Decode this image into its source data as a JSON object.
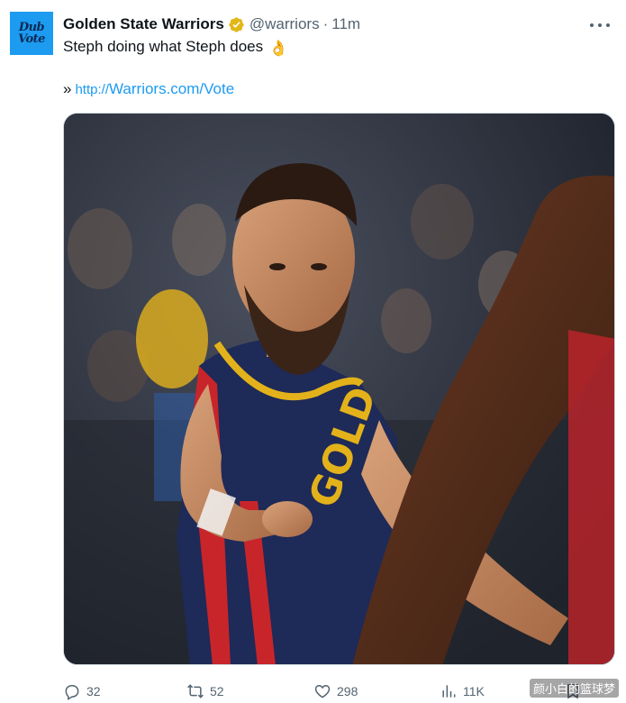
{
  "author": {
    "avatar_text_1": "Dub",
    "avatar_text_2": "Vote",
    "name": "Golden State Warriors",
    "handle": "@warriors",
    "separator": "·",
    "time": "11m",
    "verified_icon": "verified-gold-badge-icon"
  },
  "tweet": {
    "text": "Steph doing what Steph does",
    "emoji": "👌",
    "link_bullet": "»",
    "link_protocol": "http://",
    "link_domain": "Warriors.com/Vote"
  },
  "media": {
    "description_icon": "photo"
  },
  "actions": {
    "reply_count": "32",
    "retweet_count": "52",
    "like_count": "298",
    "views_count": "11K"
  },
  "watermark": "颜小白的篮球梦",
  "colors": {
    "accent": "#1d9bf0",
    "muted": "#536471",
    "text": "#0f1419",
    "verified_gold": "#e2b719"
  }
}
